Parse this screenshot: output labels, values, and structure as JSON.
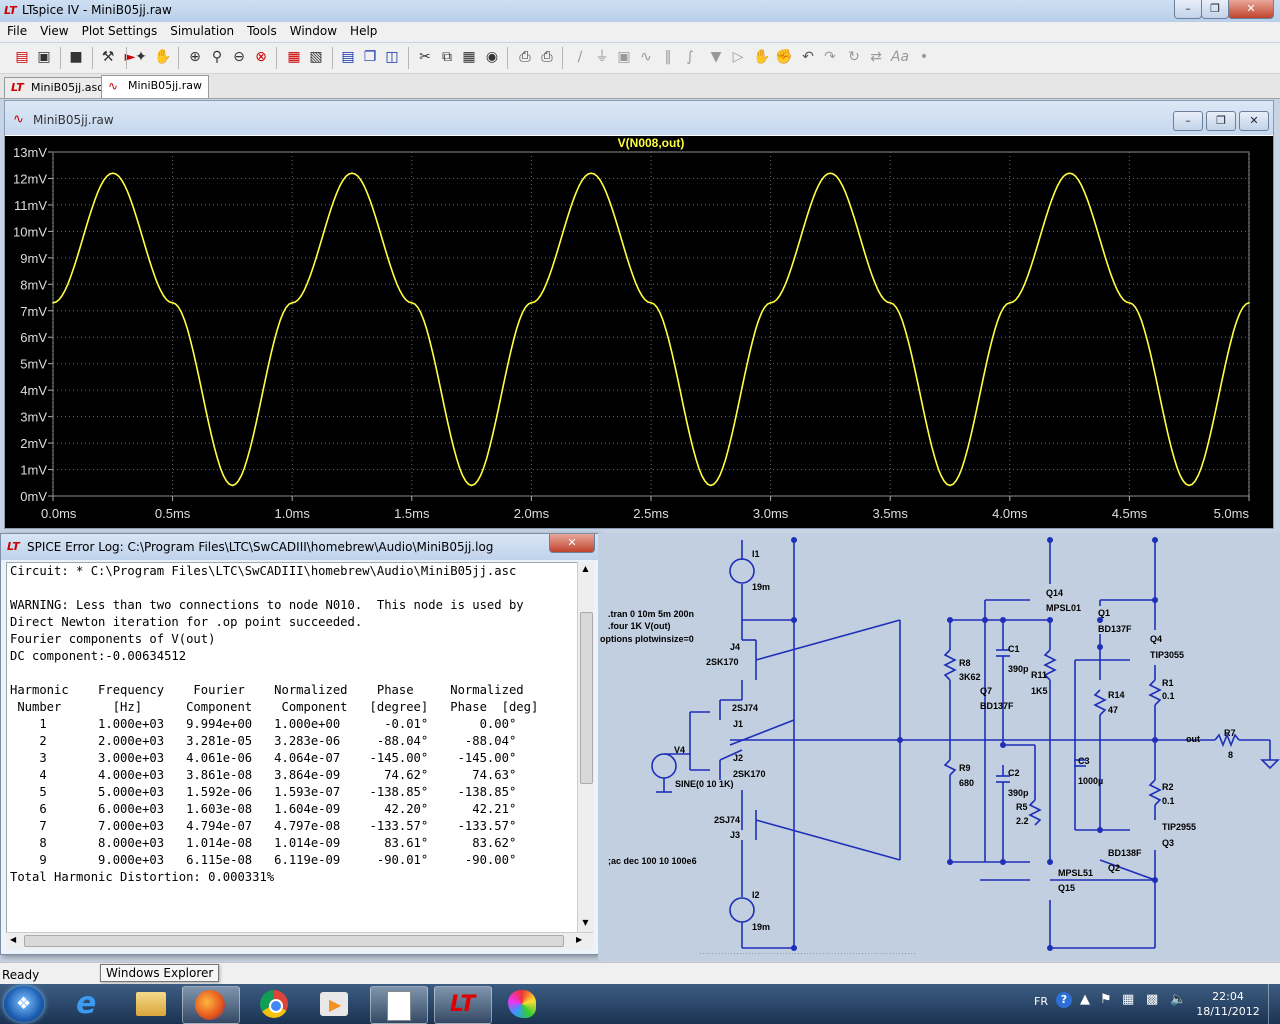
{
  "app": {
    "title": "LTspice IV - MiniB05jj.raw",
    "menu": [
      "File",
      "View",
      "Plot Settings",
      "Simulation",
      "Tools",
      "Window",
      "Help"
    ]
  },
  "tabs": [
    {
      "label": "MiniB05jj.asc"
    },
    {
      "label": "MiniB05jj.raw"
    }
  ],
  "plot_window": {
    "title": "MiniB05jj.raw"
  },
  "chart_data": {
    "type": "line",
    "title": "V(N008,out)",
    "xlabel": "",
    "ylabel": "",
    "x_ticks": [
      "0.0ms",
      "0.5ms",
      "1.0ms",
      "1.5ms",
      "2.0ms",
      "2.5ms",
      "3.0ms",
      "3.5ms",
      "4.0ms",
      "4.5ms",
      "5.0ms"
    ],
    "y_ticks": [
      "13mV",
      "12mV",
      "11mV",
      "10mV",
      "9mV",
      "8mV",
      "7mV",
      "6mV",
      "5mV",
      "4mV",
      "3mV",
      "2mV",
      "1mV",
      "0mV"
    ],
    "xlim": [
      0,
      5
    ],
    "ylim": [
      0,
      13
    ],
    "grid": true,
    "background": "#000000",
    "trace_color": "#ffff40",
    "series": [
      {
        "name": "V(N008,out)",
        "x": [
          0,
          0.25,
          0.5,
          0.75,
          1.0,
          1.25,
          1.5,
          1.75,
          2.0,
          2.25,
          2.5,
          2.75,
          3.0,
          3.25,
          3.5,
          3.75,
          4.0,
          4.25,
          4.5,
          4.75,
          5.0
        ],
        "values": [
          7.3,
          12.2,
          7.3,
          0.4,
          7.3,
          12.2,
          7.3,
          0.4,
          7.3,
          12.2,
          7.3,
          0.4,
          7.3,
          12.2,
          7.3,
          0.4,
          7.3,
          12.2,
          7.3,
          0.4,
          7.3
        ]
      }
    ]
  },
  "error_log": {
    "title": "SPICE Error Log: C:\\Program Files\\LTC\\SwCADIII\\homebrew\\Audio\\MiniB05jj.log",
    "lines": [
      "Circuit: * C:\\Program Files\\LTC\\SwCADIII\\homebrew\\Audio\\MiniB05jj.asc",
      "",
      "WARNING: Less than two connections to node N010.  This node is used by",
      "Direct Newton iteration for .op point succeeded.",
      "Fourier components of V(out)",
      "DC component:-0.00634512",
      "",
      "Harmonic    Frequency    Fourier    Normalized    Phase     Normalized",
      " Number       [Hz]      Component    Component   [degree]   Phase  [deg]",
      "    1       1.000e+03   9.994e+00   1.000e+00      -0.01°       0.00°",
      "    2       2.000e+03   3.281e-05   3.283e-06     -88.04°     -88.04°",
      "    3       3.000e+03   4.061e-06   4.064e-07    -145.00°    -145.00°",
      "    4       4.000e+03   3.861e-08   3.864e-09      74.62°      74.63°",
      "    5       5.000e+03   1.592e-06   1.593e-07    -138.85°    -138.85°",
      "    6       6.000e+03   1.603e-08   1.604e-09      42.20°      42.21°",
      "    7       7.000e+03   4.794e-07   4.797e-08    -133.57°    -133.57°",
      "    8       8.000e+03   1.014e-08   1.014e-09      83.61°      83.62°",
      "    9       9.000e+03   6.115e-08   6.119e-09     -90.01°     -90.00°",
      "Total Harmonic Distortion: 0.000331%"
    ]
  },
  "schematic": {
    "directives": [
      ".tran 0 10m 5m 200n",
      ".four 1K V(out)",
      "options plotwinsize=0",
      ";ac dec 100 10 100e6"
    ],
    "labels": [
      {
        "t": "I1"
      },
      {
        "t": "19m"
      },
      {
        "t": "J4"
      },
      {
        "t": "2SK170"
      },
      {
        "t": "2SJ74"
      },
      {
        "t": "J1"
      },
      {
        "t": "V4"
      },
      {
        "t": "J2"
      },
      {
        "t": "2SK170"
      },
      {
        "t": "SINE(0 10 1K)"
      },
      {
        "t": "2SJ74"
      },
      {
        "t": "J3"
      },
      {
        "t": "I2"
      },
      {
        "t": "19m"
      },
      {
        "t": "R8"
      },
      {
        "t": "3K62"
      },
      {
        "t": "Q7"
      },
      {
        "t": "BD137F"
      },
      {
        "t": "R9"
      },
      {
        "t": "680"
      },
      {
        "t": "C1"
      },
      {
        "t": "390p"
      },
      {
        "t": "C2"
      },
      {
        "t": "390p"
      },
      {
        "t": "R5"
      },
      {
        "t": "2.2"
      },
      {
        "t": "R11"
      },
      {
        "t": "1K5"
      },
      {
        "t": "Q14"
      },
      {
        "t": "MPSL01"
      },
      {
        "t": "Q1"
      },
      {
        "t": "BD137F"
      },
      {
        "t": "Q4"
      },
      {
        "t": "TIP3055"
      },
      {
        "t": "R1"
      },
      {
        "t": "0.1"
      },
      {
        "t": "R14"
      },
      {
        "t": "47"
      },
      {
        "t": "C3"
      },
      {
        "t": "1000µ"
      },
      {
        "t": "out"
      },
      {
        "t": "R7"
      },
      {
        "t": "8"
      },
      {
        "t": "R2"
      },
      {
        "t": "0.1"
      },
      {
        "t": "TIP2955"
      },
      {
        "t": "Q3"
      },
      {
        "t": "BD138F"
      },
      {
        "t": "Q2"
      },
      {
        "t": "MPSL51"
      },
      {
        "t": "Q15"
      }
    ]
  },
  "status": {
    "text": "Ready",
    "tooltip": "Windows Explorer"
  },
  "taskbar": {
    "lang": "FR",
    "time": "22:04",
    "date": "18/11/2012"
  }
}
